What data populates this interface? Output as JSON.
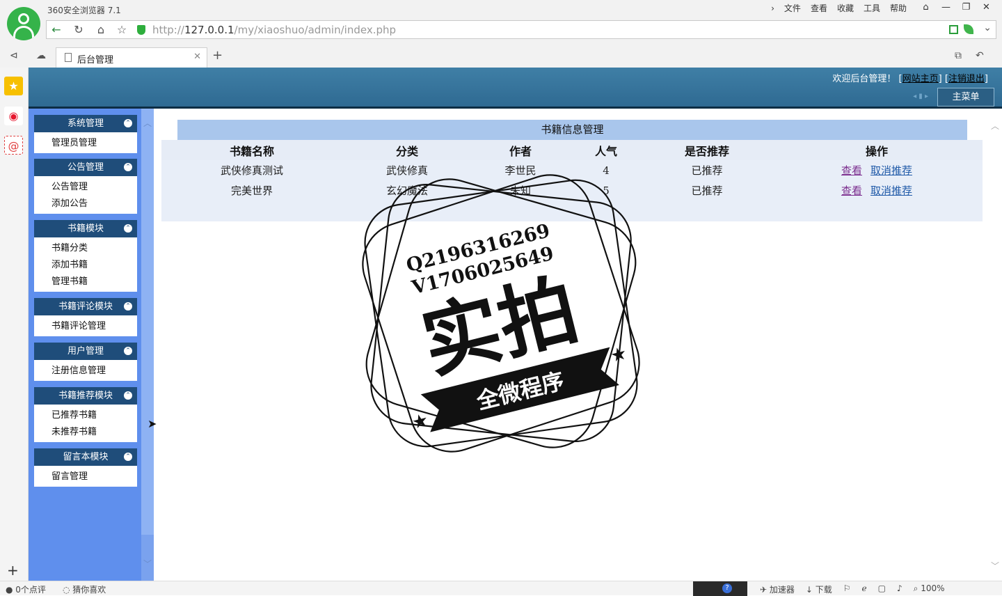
{
  "browser": {
    "app_title": "360安全浏览器 7.1",
    "menu": [
      "文件",
      "查看",
      "收藏",
      "工具",
      "帮助"
    ],
    "url_scheme": "http://",
    "url_host": "127.0.0.1",
    "url_path": "/my/xiaoshuo/admin/index.php",
    "tab_title": "后台管理"
  },
  "header": {
    "welcome": "欢迎后台管理！",
    "home_link": "网站主页",
    "logout_link": "注销退出",
    "main_menu": "主菜单"
  },
  "nav": {
    "groups": [
      {
        "title": "系统管理",
        "items": [
          "管理员管理"
        ]
      },
      {
        "title": "公告管理",
        "items": [
          "公告管理",
          "添加公告"
        ]
      },
      {
        "title": "书籍模块",
        "items": [
          "书籍分类",
          "添加书籍",
          "管理书籍"
        ]
      },
      {
        "title": "书籍评论模块",
        "items": [
          "书籍评论管理"
        ]
      },
      {
        "title": "用户管理",
        "items": [
          "注册信息管理"
        ]
      },
      {
        "title": "书籍推荐模块",
        "items": [
          "已推荐书籍",
          "未推荐书籍"
        ]
      },
      {
        "title": "留言本模块",
        "items": [
          "留言管理"
        ]
      }
    ]
  },
  "content": {
    "section_title": "书籍信息管理",
    "columns": [
      "书籍名称",
      "分类",
      "作者",
      "人气",
      "是否推荐",
      "操作"
    ],
    "rows": [
      {
        "name": "武侠修真测试",
        "category": "武侠修真",
        "author": "李世民",
        "popularity": "4",
        "recommended": "已推荐",
        "view": "查看",
        "action": "取消推荐"
      },
      {
        "name": "完美世界",
        "category": "玄幻魔法",
        "author": "未知",
        "popularity": "5",
        "recommended": "已推荐",
        "view": "查看",
        "action": "取消推荐"
      }
    ]
  },
  "watermark": {
    "line1": "Q2196316269",
    "line2": "V1706025649",
    "big": "实拍",
    "banner": "全微程序"
  },
  "status": {
    "comments": "0个点评",
    "guess": "猜你喜欢",
    "accelerator": "加速器",
    "download": "下载",
    "zoom": "100%"
  }
}
